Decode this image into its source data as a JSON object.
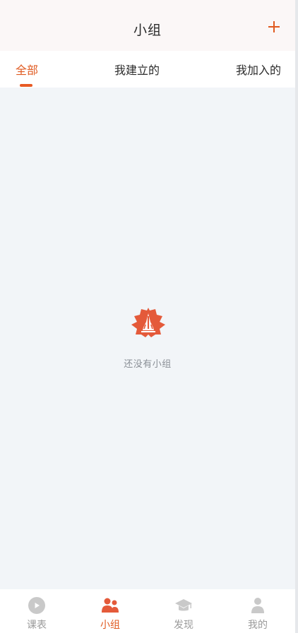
{
  "header": {
    "title": "小组",
    "add_icon": "plus-icon"
  },
  "tabs": [
    {
      "label": "全部",
      "active": true
    },
    {
      "label": "我建立的",
      "active": false
    },
    {
      "label": "我加入的",
      "active": false
    }
  ],
  "empty_state": {
    "icon": "flower-logo-icon",
    "text": "还没有小组"
  },
  "bottom_nav": [
    {
      "label": "课表",
      "icon": "play-circle-icon",
      "active": false
    },
    {
      "label": "小组",
      "icon": "group-icon",
      "active": true
    },
    {
      "label": "发现",
      "icon": "graduation-cap-icon",
      "active": false
    },
    {
      "label": "我的",
      "icon": "person-icon",
      "active": false
    }
  ],
  "colors": {
    "accent": "#e05a20",
    "background": "#f2f5f8",
    "inactive": "#9a9a9a"
  }
}
